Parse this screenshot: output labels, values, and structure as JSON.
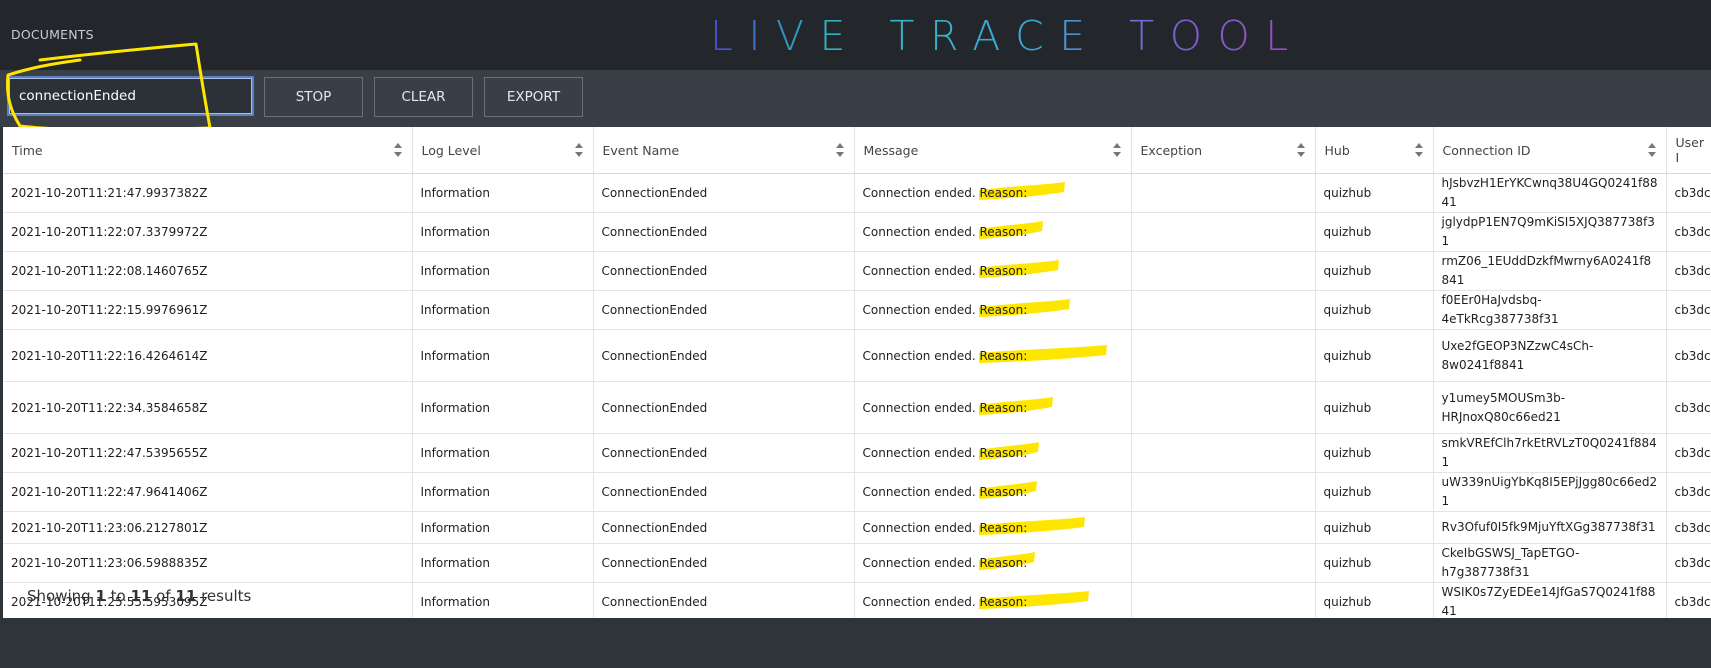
{
  "header": {
    "documents_link": "DOCUMENTS",
    "title": "LIVE TRACE TOOL"
  },
  "toolbar": {
    "search_value": "connectionEnded",
    "stop_label": "STOP",
    "clear_label": "CLEAR",
    "export_label": "EXPORT"
  },
  "table": {
    "columns": [
      "Time",
      "Log Level",
      "Event Name",
      "Message",
      "Exception",
      "Hub",
      "Connection ID",
      "User I"
    ],
    "rows": [
      {
        "time": "2021-10-20T11:21:47.9937382Z",
        "level": "Information",
        "event": "ConnectionEnded",
        "message": "Connection ended.",
        "reason": "Reason:",
        "exception": "",
        "hub": "quizhub",
        "connection_id": "hJsbvzH1ErYKCwnq38U4GQ0241f8841",
        "user": "cb3dc"
      },
      {
        "time": "2021-10-20T11:22:07.3379972Z",
        "level": "Information",
        "event": "ConnectionEnded",
        "message": "Connection ended.",
        "reason": "Reason:",
        "exception": "",
        "hub": "quizhub",
        "connection_id": "jglydpP1EN7Q9mKiSI5XJQ387738f31",
        "user": "cb3dc"
      },
      {
        "time": "2021-10-20T11:22:08.1460765Z",
        "level": "Information",
        "event": "ConnectionEnded",
        "message": "Connection ended.",
        "reason": "Reason:",
        "exception": "",
        "hub": "quizhub",
        "connection_id": "rmZ06_1EUddDzkfMwrny6A0241f8841",
        "user": "cb3dc"
      },
      {
        "time": "2021-10-20T11:22:15.9976961Z",
        "level": "Information",
        "event": "ConnectionEnded",
        "message": "Connection ended.",
        "reason": "Reason:",
        "exception": "",
        "hub": "quizhub",
        "connection_id": "f0EEr0HaJvdsbq-4eTkRcg387738f31",
        "user": "cb3dc"
      },
      {
        "time": "2021-10-20T11:22:16.4264614Z",
        "level": "Information",
        "event": "ConnectionEnded",
        "message": "Connection ended.",
        "reason": "Reason:",
        "exception": "",
        "hub": "quizhub",
        "connection_id": "Uxe2fGEOP3NZzwC4sCh-8w0241f8841",
        "user": "cb3dc"
      },
      {
        "time": "2021-10-20T11:22:34.3584658Z",
        "level": "Information",
        "event": "ConnectionEnded",
        "message": "Connection ended.",
        "reason": "Reason:",
        "exception": "",
        "hub": "quizhub",
        "connection_id": "y1umey5MOUSm3b-HRJnoxQ80c66ed21",
        "user": "cb3dc"
      },
      {
        "time": "2021-10-20T11:22:47.5395655Z",
        "level": "Information",
        "event": "ConnectionEnded",
        "message": "Connection ended.",
        "reason": "Reason:",
        "exception": "",
        "hub": "quizhub",
        "connection_id": "smkVREfClh7rkEtRVLzT0Q0241f8841",
        "user": "cb3dc"
      },
      {
        "time": "2021-10-20T11:22:47.9641406Z",
        "level": "Information",
        "event": "ConnectionEnded",
        "message": "Connection ended.",
        "reason": "Reason:",
        "exception": "",
        "hub": "quizhub",
        "connection_id": "uW339nUigYbKq8I5EPjJgg80c66ed21",
        "user": "cb3dc"
      },
      {
        "time": "2021-10-20T11:23:06.2127801Z",
        "level": "Information",
        "event": "ConnectionEnded",
        "message": "Connection ended.",
        "reason": "Reason:",
        "exception": "",
        "hub": "quizhub",
        "connection_id": "Rv3Ofuf0I5fk9MjuYftXGg387738f31",
        "user": "cb3dc"
      },
      {
        "time": "2021-10-20T11:23:06.5988835Z",
        "level": "Information",
        "event": "ConnectionEnded",
        "message": "Connection ended.",
        "reason": "Reason:",
        "exception": "",
        "hub": "quizhub",
        "connection_id": "CkeIbGSWSJ_TapETGO-h7g387738f31",
        "user": "cb3dc"
      },
      {
        "time": "2021-10-20T11:25:55.5953095Z",
        "level": "Information",
        "event": "ConnectionEnded",
        "message": "Connection ended.",
        "reason": "Reason:",
        "exception": "",
        "hub": "quizhub",
        "connection_id": "WSIK0s7ZyEDEe14JfGaS7Q0241f8841",
        "user": "cb3dc"
      }
    ]
  },
  "footer": {
    "prefix": "Showing",
    "from": "1",
    "to_word": "to",
    "to": "11",
    "of_word": "of",
    "total": "11",
    "suffix": "results"
  },
  "colors": {
    "header_bg": "#23262b",
    "toolbar_bg": "#3a3e46",
    "annotation": "#ffe600",
    "input_border": "#5c7fc4"
  }
}
